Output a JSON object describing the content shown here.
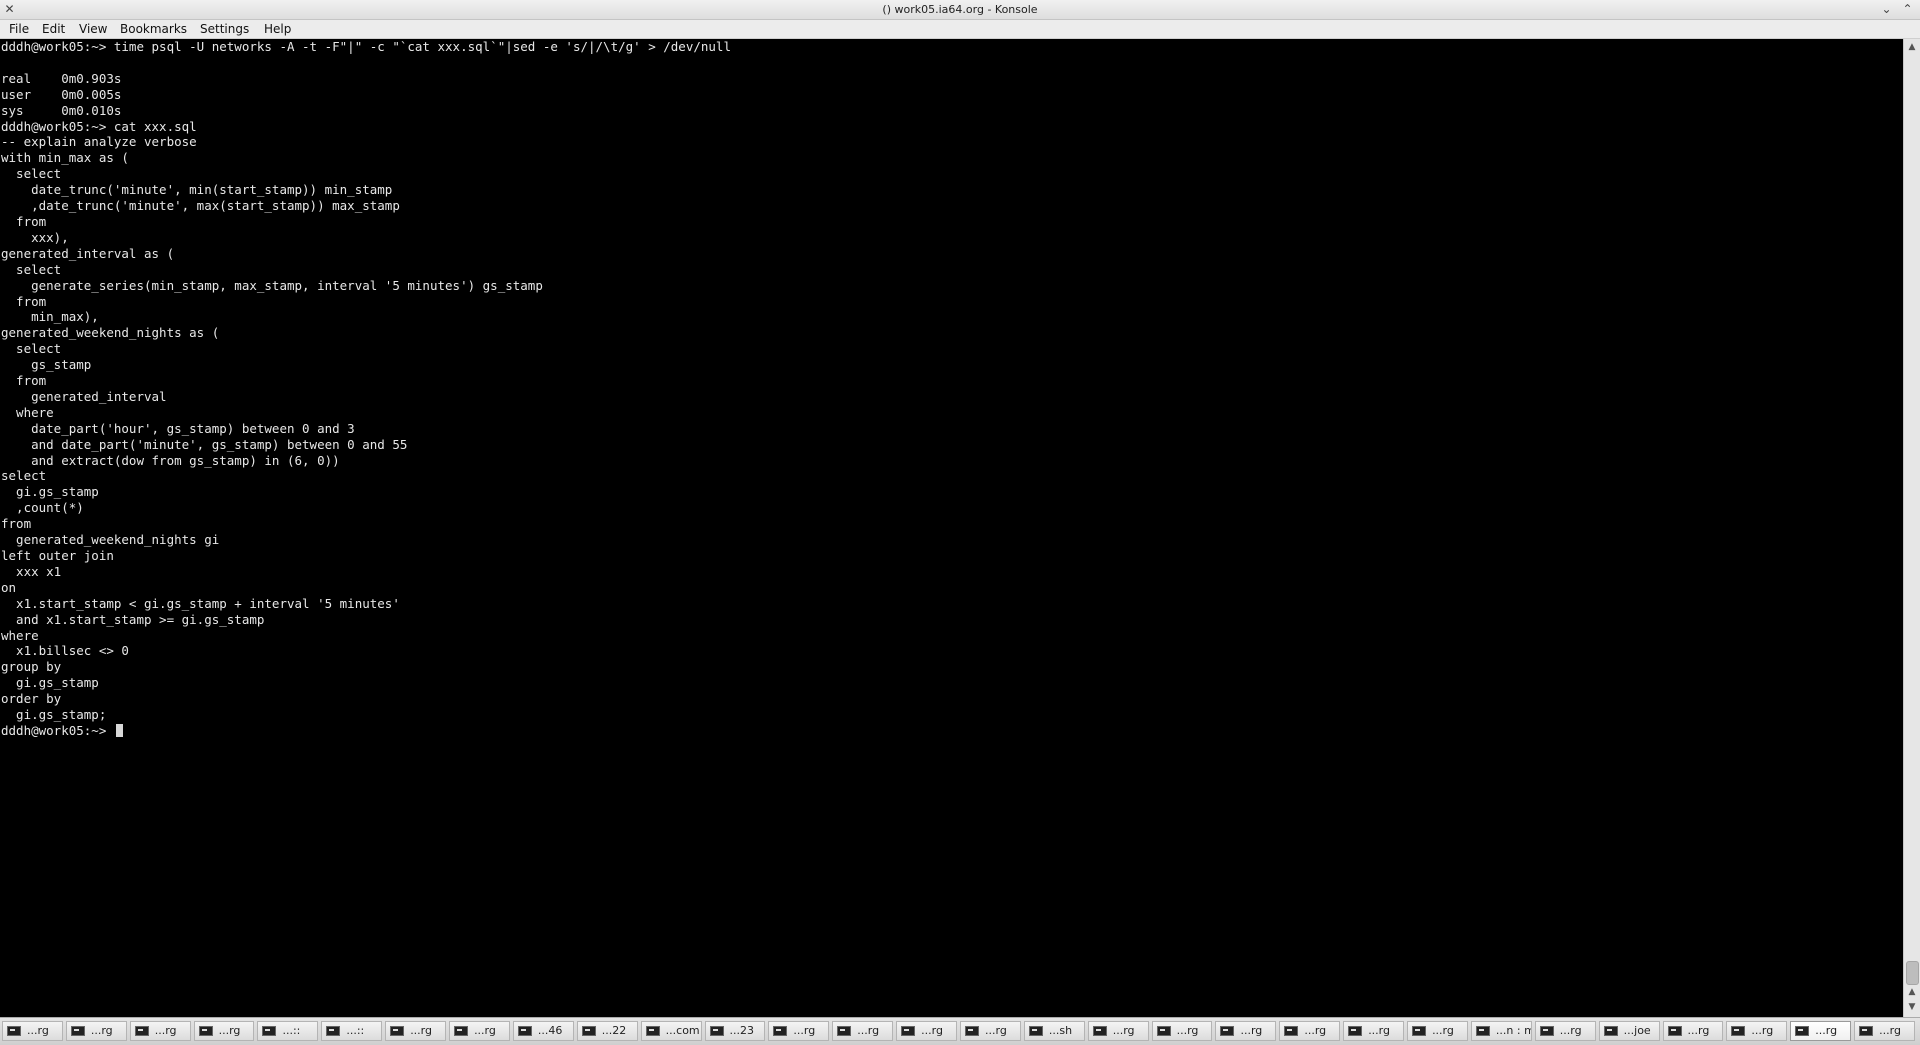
{
  "window": {
    "title": "() work05.ia64.org - Konsole"
  },
  "menu": [
    "File",
    "Edit",
    "View",
    "Bookmarks",
    "Settings",
    "Help"
  ],
  "terminal": {
    "lines": [
      "dddh@work05:~> time psql -U networks -A -t -F\"|\" -c \"`cat xxx.sql`\"|sed -e 's/|/\\t/g' > /dev/null",
      "",
      "real    0m0.903s",
      "user    0m0.005s",
      "sys     0m0.010s",
      "dddh@work05:~> cat xxx.sql",
      "-- explain analyze verbose",
      "with min_max as (",
      "  select",
      "    date_trunc('minute', min(start_stamp)) min_stamp",
      "    ,date_trunc('minute', max(start_stamp)) max_stamp",
      "  from",
      "    xxx),",
      "generated_interval as (",
      "  select",
      "    generate_series(min_stamp, max_stamp, interval '5 minutes') gs_stamp",
      "  from",
      "    min_max),",
      "generated_weekend_nights as (",
      "  select",
      "    gs_stamp",
      "  from",
      "    generated_interval",
      "  where",
      "    date_part('hour', gs_stamp) between 0 and 3",
      "    and date_part('minute', gs_stamp) between 0 and 55",
      "    and extract(dow from gs_stamp) in (6, 0))",
      "select",
      "  gi.gs_stamp",
      "  ,count(*)",
      "from",
      "  generated_weekend_nights gi",
      "left outer join",
      "  xxx x1",
      "on",
      "  x1.start_stamp < gi.gs_stamp + interval '5 minutes'",
      "  and x1.start_stamp >= gi.gs_stamp",
      "where",
      "  x1.billsec <> 0",
      "group by",
      "  gi.gs_stamp",
      "order by",
      "  gi.gs_stamp;"
    ],
    "prompt": "dddh@work05:~> "
  },
  "taskbar": [
    {
      "label": "...rg",
      "active": false
    },
    {
      "label": "...rg",
      "active": false
    },
    {
      "label": "...rg",
      "active": false
    },
    {
      "label": "...rg",
      "active": false
    },
    {
      "label": "...::",
      "active": false
    },
    {
      "label": "...::",
      "active": false
    },
    {
      "label": "...rg",
      "active": false
    },
    {
      "label": "...rg",
      "active": false
    },
    {
      "label": "...46",
      "active": false
    },
    {
      "label": "...22",
      "active": false
    },
    {
      "label": "...com",
      "active": false
    },
    {
      "label": "...23",
      "active": false
    },
    {
      "label": "...rg",
      "active": false
    },
    {
      "label": "...rg",
      "active": false
    },
    {
      "label": "...rg",
      "active": false
    },
    {
      "label": "...rg",
      "active": false
    },
    {
      "label": "...sh",
      "active": false
    },
    {
      "label": "...rg",
      "active": false
    },
    {
      "label": "...rg",
      "active": false
    },
    {
      "label": "...rg",
      "active": false
    },
    {
      "label": "...rg",
      "active": false
    },
    {
      "label": "...rg",
      "active": false
    },
    {
      "label": "...rg",
      "active": false
    },
    {
      "label": "...n : mplayer",
      "active": false
    },
    {
      "label": "...rg",
      "active": false
    },
    {
      "label": "...joe",
      "active": false
    },
    {
      "label": "...rg",
      "active": false
    },
    {
      "label": "...rg",
      "active": false
    },
    {
      "label": "...rg",
      "active": true
    },
    {
      "label": "...rg",
      "active": false
    }
  ]
}
